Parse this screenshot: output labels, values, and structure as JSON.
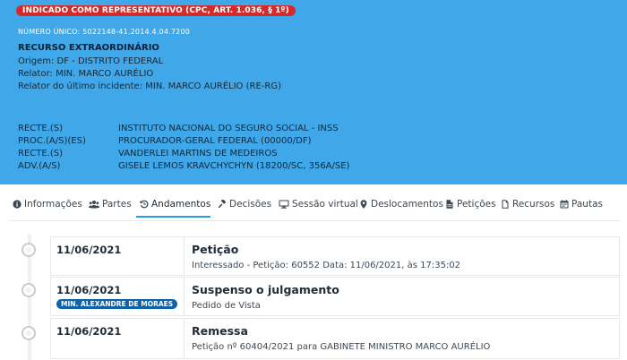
{
  "header": {
    "badge": "INDICADO COMO REPRESENTATIVO (CPC, ART. 1.036, § 1º)",
    "numero_unico": "NÚMERO ÚNICO: 5022148-41.2014.4.04.7200",
    "classe": "RECURSO EXTRAORDINÁRIO",
    "origem": "Origem: DF - DISTRITO FEDERAL",
    "relator": "Relator: MIN. MARCO AURÉLIO",
    "relator_incidente": "Relator do último incidente: MIN. MARCO AURÉLIO (RE-RG)"
  },
  "parties": [
    {
      "role": "RECTE.(S)",
      "name": "INSTITUTO NACIONAL DO SEGURO SOCIAL - INSS"
    },
    {
      "role": "PROC.(A/S)(ES)",
      "name": "PROCURADOR-GERAL FEDERAL (00000/DF)"
    },
    {
      "role": "RECTE.(S)",
      "name": "VANDERLEI MARTINS DE MEDEIROS"
    },
    {
      "role": "ADV.(A/S)",
      "name": "GISELE LEMOS KRAVCHYCHYN (18200/SC, 356A/SE)"
    }
  ],
  "tabs": [
    {
      "label": "Informações",
      "icon": "info-circle-icon"
    },
    {
      "label": "Partes",
      "icon": "users-icon"
    },
    {
      "label": "Andamentos",
      "icon": "history-icon",
      "active": true
    },
    {
      "label": "Decisões",
      "icon": "gavel-icon"
    },
    {
      "label": "Sessão virtual",
      "icon": "desktop-icon"
    },
    {
      "label": "Deslocamentos",
      "icon": "map-marker-icon"
    },
    {
      "label": "Petições",
      "icon": "file-pdf-icon"
    },
    {
      "label": "Recursos",
      "icon": "file-icon"
    },
    {
      "label": "Pautas",
      "icon": "calendar-icon"
    }
  ],
  "andamentos": [
    {
      "date": "11/06/2021",
      "title": "Petição",
      "description": "Interessado - Petição: 60552 Data: 11/06/2021, às 17:35:02",
      "minister": ""
    },
    {
      "date": "11/06/2021",
      "title": "Suspenso o julgamento",
      "description": "Pedido de Vista",
      "minister": "MIN. ALEXANDRE DE MORAES"
    },
    {
      "date": "11/06/2021",
      "title": "Remessa",
      "description": "Petição nº 60404/2021 para GABINETE MINISTRO MARCO AURÉLIO",
      "minister": ""
    }
  ],
  "colors": {
    "header_bg": "#40a7e8",
    "badge_red": "#d42a2a",
    "minister_badge": "#0e62a5",
    "active_tab_underline": "#2a9ce6"
  }
}
